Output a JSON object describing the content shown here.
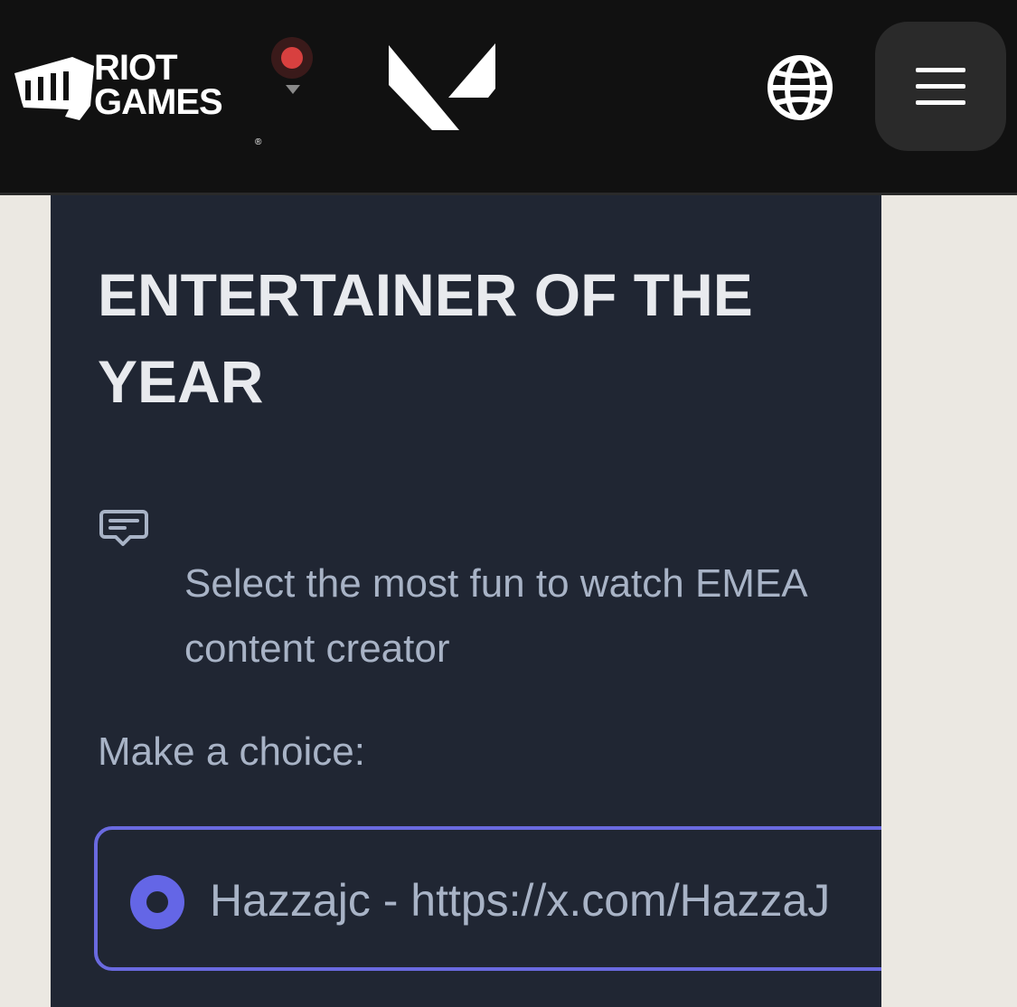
{
  "header": {
    "brand_line1": "RIOT",
    "brand_line2": "GAMES",
    "brand_mark": "®",
    "icons": {
      "brand": "riot-games-logo",
      "switcher": "game-switcher-icon",
      "game": "valorant-logo",
      "language": "globe-icon",
      "menu": "hamburger-menu-icon"
    }
  },
  "question": {
    "title": "ENTERTAINER OF THE YEAR",
    "description": "Select the most fun to watch EMEA content creator",
    "prompt": "Make a choice:",
    "options": [
      {
        "label": "Hazzajc - https://x.com/HazzaJ",
        "selected": true
      }
    ]
  },
  "colors": {
    "nav_bg": "#111111",
    "card_bg": "#202633",
    "accent": "#6466e6",
    "page_bg": "#ebe8e2",
    "switcher_dot": "#d8403f"
  }
}
